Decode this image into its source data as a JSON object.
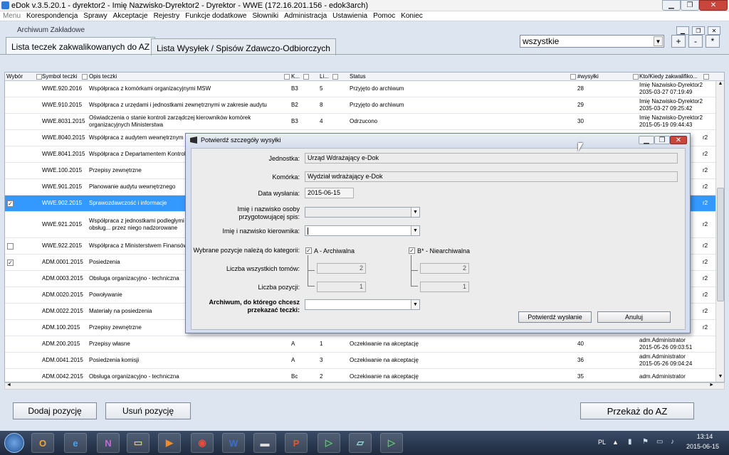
{
  "window": {
    "title": "eDok v.3.5.20.1 - dyrektor2 - Imię Nazwisko-Dyrektor2 - Dyrektor - WWE   (172.16.201.156 - edok3arch)"
  },
  "menu": [
    "Menu",
    "Korespondencja",
    "Sprawy",
    "Akceptacje",
    "Rejestry",
    "Funkcje dodatkowe",
    "Słowniki",
    "Administracja",
    "Ustawienia",
    "Pomoc",
    "Koniec"
  ],
  "inner_window": {
    "title": "Archiwum Zakładowe"
  },
  "tabs": [
    {
      "label": "Lista teczek zakwalikowanych do AZ"
    },
    {
      "label": "Lista Wysyłek / Spisów Zdawczo-Odbiorczych"
    }
  ],
  "filter": {
    "value": "wszystkie",
    "plus": "+",
    "minus": "-",
    "star": "*"
  },
  "table": {
    "columns": [
      "Wybór",
      "Symbol teczki",
      "Opis teczki",
      "K...",
      "Li...",
      "Status",
      "#wysyłki",
      "Kto/Kiedy zakwalifiko..."
    ],
    "rows": [
      {
        "checked": false,
        "symbol": "WWE.920.2016",
        "desc": "Współpraca z komórkami organizacyjnymi MSW",
        "k": "B3",
        "li": "5",
        "status": "Przyjęto do archiwum",
        "wys": "28",
        "kto": "Imię Nazwisko-Dyrektor2",
        "kiedy": "2035-03-27 07:19:49"
      },
      {
        "checked": false,
        "symbol": "WWE.910.2015",
        "desc": "Współpraca z urzędami i jednostkami zewnętrznymi w zakresie audytu",
        "k": "B2",
        "li": "8",
        "status": "Przyjęto do archiwum",
        "wys": "29",
        "kto": "Imię Nazwisko-Dyrektor2",
        "kiedy": "2035-03-27 09:25:42"
      },
      {
        "checked": false,
        "symbol": "WWE.8031.2015",
        "desc": "Oświadczenia o stanie kontroli zarządczej kierowników komórek organizacyjnych Ministerstwa",
        "k": "B3",
        "li": "4",
        "status": "Odrzucono",
        "wys": "30",
        "kto": "Imię Nazwisko-Dyrektor2",
        "kiedy": "2015-05-19 09:44:43"
      },
      {
        "checked": false,
        "symbol": "WWE.8040.2015",
        "desc": "Współpraca z audytem wewnętrznym",
        "k": "",
        "li": "",
        "status": "",
        "wys": "",
        "kto": "",
        "kiedy": ""
      },
      {
        "checked": false,
        "symbol": "WWE.8041.2015",
        "desc": "Współpraca z Departamentem Kontroli,",
        "k": "",
        "li": "",
        "status": "",
        "wys": "",
        "kto": "",
        "kiedy": ""
      },
      {
        "checked": false,
        "symbol": "WWE.100.2015",
        "desc": "Przepisy zewnętrzne",
        "k": "",
        "li": "",
        "status": "",
        "wys": "",
        "kto": "",
        "kiedy": ""
      },
      {
        "checked": false,
        "symbol": "WWE.901.2015",
        "desc": "Planowanie audytu wewnętrznego",
        "k": "",
        "li": "",
        "status": "",
        "wys": "",
        "kto": "",
        "kiedy": ""
      },
      {
        "checked": true,
        "symbol": "WWE.902.2015",
        "desc": "Sprawozdawczość i informacje",
        "k": "",
        "li": "",
        "status": "",
        "wys": "",
        "kto": "",
        "kiedy": ""
      },
      {
        "checked": false,
        "symbol": "WWE.921.2015",
        "desc": "Współpraca z jednostkami podległymi M... nadzorowanymi lub jednostkami obsług... przez niego nadzorowane",
        "k": "",
        "li": "",
        "status": "",
        "wys": "",
        "kto": "",
        "kiedy": ""
      },
      {
        "checked": false,
        "symbol": "WWE.922.2015",
        "desc": "Współpraca z Ministerstwem Finansów",
        "k": "",
        "li": "",
        "status": "",
        "wys": "",
        "kto": "",
        "kiedy": ""
      },
      {
        "checked": true,
        "symbol": "ADM.0001.2015",
        "desc": "Posiedzenia",
        "k": "",
        "li": "",
        "status": "",
        "wys": "",
        "kto": "",
        "kiedy": ""
      },
      {
        "checked": false,
        "symbol": "ADM.0003.2015",
        "desc": "Obsługa organizacyjno - techniczna",
        "k": "",
        "li": "",
        "status": "",
        "wys": "",
        "kto": "",
        "kiedy": ""
      },
      {
        "checked": false,
        "symbol": "ADM.0020.2015",
        "desc": "Powoływanie",
        "k": "",
        "li": "",
        "status": "",
        "wys": "",
        "kto": "",
        "kiedy": ""
      },
      {
        "checked": false,
        "symbol": "ADM.0022.2015",
        "desc": "Materiały na posiedzenia",
        "k": "",
        "li": "",
        "status": "",
        "wys": "",
        "kto": "",
        "kiedy": ""
      },
      {
        "checked": false,
        "symbol": "ADM.100.2015",
        "desc": "Przepisy zewnętrzne",
        "k": "",
        "li": "",
        "status": "",
        "wys": "",
        "kto": "",
        "kiedy": ""
      },
      {
        "checked": false,
        "symbol": "ADM.200.2015",
        "desc": "Przepisy własne",
        "k": "A",
        "li": "1",
        "status": "Oczekiwanie na akceptację",
        "wys": "40",
        "kto": "adm.Administrator",
        "kiedy": "2015-05-26 09:03:51"
      },
      {
        "checked": false,
        "symbol": "ADM.0041.2015",
        "desc": "Posiedzenia komisji",
        "k": "A",
        "li": "3",
        "status": "Oczekiwanie na akceptację",
        "wys": "36",
        "kto": "adm.Administrator",
        "kiedy": "2015-05-26 09:04:24"
      },
      {
        "checked": false,
        "symbol": "ADM.0042.2015",
        "desc": "Obsługa organizacyjno - techniczna",
        "k": "Bc",
        "li": "2",
        "status": "Oczekiwanie na akceptację",
        "wys": "35",
        "kto": "adm.Administrator",
        "kiedy": ""
      }
    ],
    "right_partial": [
      "r2",
      "r2",
      "r2",
      "r2",
      "r2",
      "r2",
      "r2",
      "r2",
      "r2",
      "r2",
      "r2",
      "r2",
      "r2"
    ]
  },
  "buttons": {
    "add": "Dodaj pozycję",
    "remove": "Usuń pozycję",
    "transfer": "Przekaż do AZ"
  },
  "dialog": {
    "title": "Potwierdź szczegóły wysyłki",
    "jednostka_label": "Jednostka:",
    "jednostka_value": "Urząd Wdrażający e-Dok",
    "komorka_label": "Komórka:",
    "komorka_value": "Wydział wdrażający e-Dok",
    "data_label": "Data wysłania:",
    "data_value": "2015-06-15",
    "osoba_label_1": "Imię i nazwisko osoby",
    "osoba_label_2": "przygotowującej spis:",
    "kier_label": "Imię i nazwisko kierownika:",
    "kategorie_label": "Wybrane pozycje należą do kategorii:",
    "cat_a": "A - Archiwalna",
    "cat_b": "B* - Niearchiwalna",
    "tomow_label": "Liczba wszystkich tomów:",
    "pozycji_label": "Liczba pozycji:",
    "a_tomow": "2",
    "a_pozycji": "1",
    "b_tomow": "2",
    "b_pozycji": "1",
    "archiwum_label_1": "Archiwum, do którego chcesz",
    "archiwum_label_2": "przekazać teczki:",
    "confirm": "Potwierdź wysłanie",
    "cancel": "Anuluj"
  },
  "taskbar": {
    "lang": "PL",
    "time": "13:14",
    "date": "2015-06-15"
  }
}
